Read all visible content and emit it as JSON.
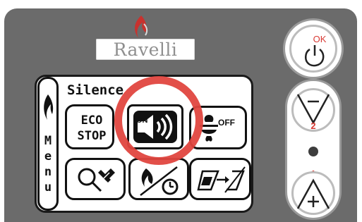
{
  "brand": {
    "name": "Ravelli"
  },
  "screen": {
    "title": "Silence",
    "menu_letters": [
      "M",
      "e",
      "n",
      "u"
    ],
    "eco_stop": [
      "ECO",
      "STOP"
    ],
    "sound_label": "ON",
    "fan_label": "OFF"
  },
  "controls": {
    "ok_label": "OK",
    "minus_number": "2",
    "plus_number": "1"
  },
  "colors": {
    "panel": "#6b6b6b",
    "accent_red": "#e0463f",
    "screen_bg": "#ffffff"
  }
}
